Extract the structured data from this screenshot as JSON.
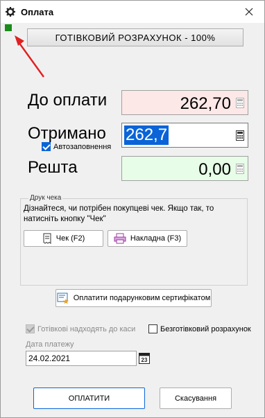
{
  "window": {
    "title": "Оплата"
  },
  "mode_button": {
    "label": "ГОТІВКОВИЙ РОЗРАХУНОК - 100%"
  },
  "amounts": {
    "due_label": "До оплати",
    "due_value": "262,70",
    "received_label": "Отримано",
    "received_value": "262,7",
    "change_label": "Решта",
    "change_value": "0,00"
  },
  "autofill": {
    "label": "Автозаповнення",
    "checked": true
  },
  "receipt_group": {
    "title": "Друк чека",
    "text": "Дізнайтеся, чи потрібен покупцеві чек. Якщо так, то натисніть кнопку \"Чек\"",
    "check_button": "Чек (F2)",
    "invoice_button": "Накладна (F3)"
  },
  "gift_cert_button": {
    "label": "Оплатити подарунковим сертифікатом"
  },
  "options": {
    "cash_to_register": "Готівкові надходять до каси",
    "cash_to_register_checked": true,
    "cashless": "Безготівковий розрахунок",
    "cashless_checked": false
  },
  "payment_date": {
    "label": "Дата платежу",
    "value": "24.02.2021",
    "calendar_day": "23"
  },
  "footer": {
    "pay_button": "ОПЛАТИТИ",
    "cancel_button": "Скасування"
  },
  "colors": {
    "due_bg": "#fde8e8",
    "change_bg": "#e7fde7",
    "selection": "#0a64d8",
    "indicator": "#1a8c1a",
    "arrow": "#e02020"
  }
}
